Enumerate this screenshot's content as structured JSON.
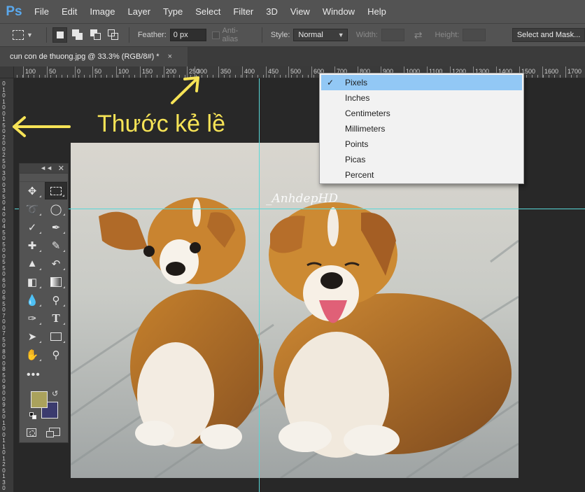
{
  "app": {
    "logo": "Ps"
  },
  "menu": [
    "File",
    "Edit",
    "Image",
    "Layer",
    "Type",
    "Select",
    "Filter",
    "3D",
    "View",
    "Window",
    "Help"
  ],
  "options": {
    "feather_label": "Feather:",
    "feather_value": "0 px",
    "antialias_label": "Anti-alias",
    "style_label": "Style:",
    "style_value": "Normal",
    "width_label": "Width:",
    "height_label": "Height:",
    "mask_button": "Select and Mask..."
  },
  "document": {
    "tab_title": "cun con de thuong.jpg @ 33.3% (RGB/8#) *",
    "close": "×"
  },
  "ruler": {
    "h_labels": [
      "100",
      "50",
      "0",
      "50",
      "100",
      "150",
      "200",
      "250",
      "300",
      "350",
      "400",
      "450",
      "500",
      "600",
      "700",
      "800",
      "900",
      "1000",
      "1100",
      "1200",
      "1300",
      "1400",
      "1500",
      "1600",
      "1700",
      "1800",
      "1900",
      "2000",
      "2100"
    ],
    "v_labels": [
      "0",
      "1",
      "0",
      "1",
      "0",
      "0",
      "1",
      "5",
      "0",
      "2",
      "0",
      "0",
      "2",
      "5",
      "0",
      "3",
      "0",
      "0",
      "3",
      "5",
      "0",
      "4",
      "0",
      "0",
      "4",
      "5",
      "0",
      "5",
      "0",
      "0",
      "5",
      "5",
      "0",
      "6",
      "0",
      "0",
      "6",
      "5",
      "0",
      "7",
      "0",
      "0",
      "7",
      "5",
      "0",
      "8",
      "0",
      "0",
      "8",
      "5",
      "0",
      "9",
      "0",
      "0",
      "9",
      "5",
      "0",
      "1",
      "0",
      "0",
      "1",
      "1",
      "0",
      "1",
      "2",
      "0",
      "1",
      "3",
      "0"
    ]
  },
  "units_menu": {
    "items": [
      "Pixels",
      "Inches",
      "Centimeters",
      "Millimeters",
      "Points",
      "Picas",
      "Percent"
    ],
    "selected": "Pixels"
  },
  "annotation": {
    "text": "Thước kẻ lề"
  },
  "watermark": {
    "text": "_AnhdepHD"
  },
  "colors": {
    "foreground": "#aaa25c",
    "background": "#3b3b6e",
    "guide": "#58d8d8",
    "annotation": "#f6e356"
  },
  "tools": [
    "move-tool",
    "marquee-tool",
    "lasso-tool",
    "quick-selection-tool",
    "crop-tool",
    "eyedropper-tool",
    "healing-brush-tool",
    "brush-tool",
    "clone-stamp-tool",
    "history-brush-tool",
    "eraser-tool",
    "gradient-tool",
    "blur-tool",
    "dodge-tool",
    "pen-tool",
    "type-tool",
    "path-selection-tool",
    "rectangle-tool",
    "hand-tool",
    "zoom-tool"
  ]
}
